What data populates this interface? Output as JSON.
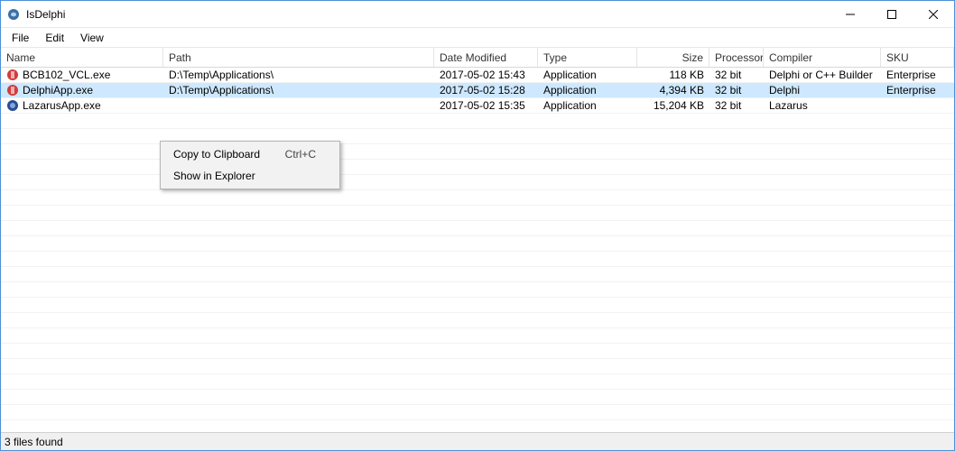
{
  "window": {
    "title": "IsDelphi"
  },
  "menubar": {
    "file": "File",
    "edit": "Edit",
    "view": "View"
  },
  "columns": {
    "name": "Name",
    "path": "Path",
    "date": "Date Modified",
    "type": "Type",
    "size": "Size",
    "proc": "Processor",
    "comp": "Compiler",
    "sku": "SKU"
  },
  "rows": [
    {
      "name": "BCB102_VCL.exe",
      "path": "D:\\Temp\\Applications\\",
      "date": "2017-05-02 15:43",
      "type": "Application",
      "size": "118 KB",
      "proc": "32 bit",
      "comp": "Delphi or C++ Builder",
      "sku": "Enterprise",
      "selected": false,
      "icon": "red"
    },
    {
      "name": "DelphiApp.exe",
      "path": "D:\\Temp\\Applications\\",
      "date": "2017-05-02 15:28",
      "type": "Application",
      "size": "4,394 KB",
      "proc": "32 bit",
      "comp": "Delphi",
      "sku": "Enterprise",
      "selected": true,
      "icon": "red"
    },
    {
      "name": "LazarusApp.exe",
      "path": "",
      "date": "2017-05-02 15:35",
      "type": "Application",
      "size": "15,204 KB",
      "proc": "32 bit",
      "comp": "Lazarus",
      "sku": "",
      "selected": false,
      "icon": "blue"
    }
  ],
  "context_menu": {
    "copy": "Copy to Clipboard",
    "copy_shortcut": "Ctrl+C",
    "show": "Show in Explorer"
  },
  "statusbar": {
    "text": "3 files found"
  }
}
